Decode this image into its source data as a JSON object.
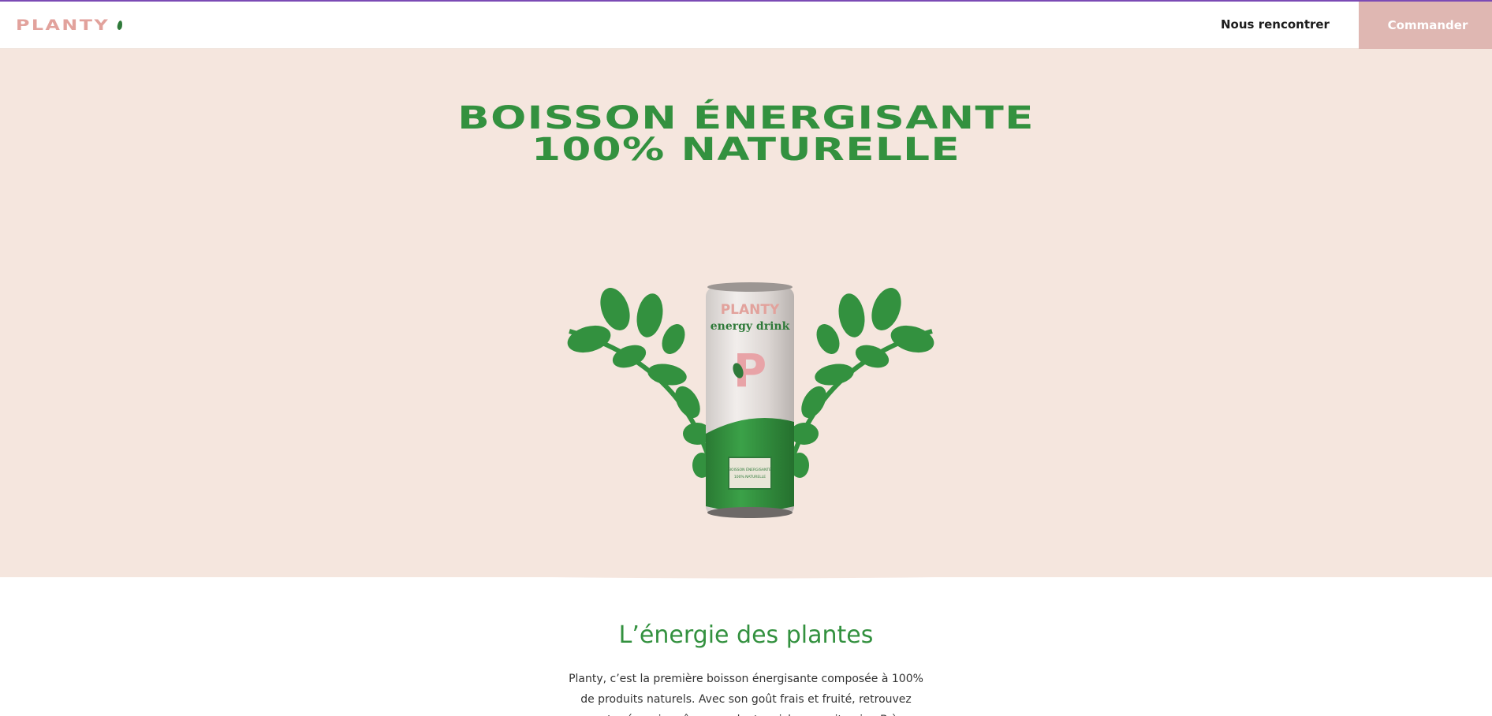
{
  "theme": {
    "brand_green": "#33913f",
    "brand_pink": "#e2a29c",
    "hero_background": "#f5e6de",
    "order_button_bg": "#dfb7b2",
    "accent_bar": "#7b4bb5"
  },
  "header": {
    "logo_text": "PLANTY",
    "logo_icon": "leaf-icon",
    "nav_link": "Nous rencontrer",
    "order_button": "Commander"
  },
  "hero": {
    "title_line_1": "BOISSON ÉNERGISANTE",
    "title_line_2": "100% NATURELLE",
    "can": {
      "brand": "PLANTY",
      "subtitle": "energy drink",
      "letter": "P",
      "label_line_1": "BOISSON ÉNERGISANTE",
      "label_line_2": "100% NATURELLE"
    }
  },
  "about": {
    "title": "L’énergie des plantes",
    "text": "Planty, c’est la première boisson énergisante composée à 100% de produits naturels. Avec son goût frais et fruité, retrouvez votre énergie grâce aux plantes riches en vitamine B à n’importe quel"
  }
}
